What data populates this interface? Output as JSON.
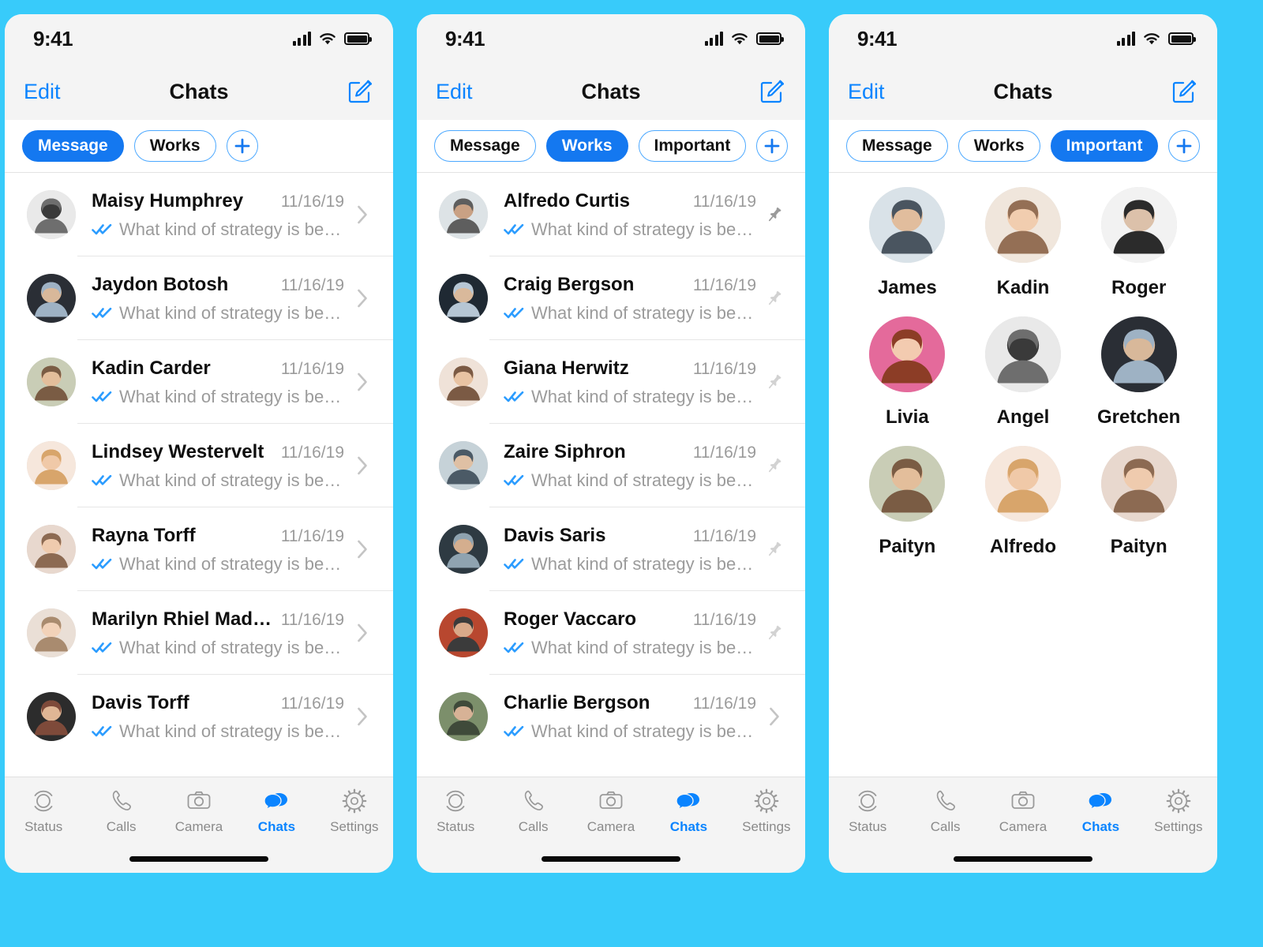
{
  "theme": {
    "background": "#38CBFA",
    "accent": "#0A84FF",
    "chip_active_bg": "#1478F0",
    "chip_border": "#4BA8FF",
    "header_bg": "#F4F4F4",
    "muted_text": "#9B9B9B",
    "tick_blue": "#2B9CFF"
  },
  "status_bar": {
    "time": "9:41",
    "signal_icon": "cellular-signal-icon",
    "wifi_icon": "wifi-icon",
    "battery_icon": "battery-icon"
  },
  "nav": {
    "edit_label": "Edit",
    "title": "Chats",
    "compose_icon": "compose-icon"
  },
  "tab_bar": {
    "items": [
      {
        "label": "Status",
        "icon": "status-rings-icon",
        "active": false
      },
      {
        "label": "Calls",
        "icon": "phone-handset-icon",
        "active": false
      },
      {
        "label": "Camera",
        "icon": "camera-icon",
        "active": false
      },
      {
        "label": "Chats",
        "icon": "chat-bubbles-icon",
        "active": true
      },
      {
        "label": "Settings",
        "icon": "gear-icon",
        "active": false
      }
    ]
  },
  "common": {
    "preview_text": "What kind of strategy is better?",
    "date": "11/16/19",
    "read_ticks_icon": "double-check-icon",
    "chevron_icon": "chevron-right-icon",
    "pin_icon": "pin-icon",
    "add_icon": "plus-icon"
  },
  "panels": [
    {
      "id": "panel-messages",
      "chips": [
        {
          "label": "Message",
          "active": true
        },
        {
          "label": "Works",
          "active": false
        }
      ],
      "has_important_chip": false,
      "view": "chat-list",
      "rows": [
        {
          "name": "Maisy Humphrey",
          "date": "11/16/19",
          "preview": "What kind of strategy is better?",
          "accessory": "chevron"
        },
        {
          "name": "Jaydon Botosh",
          "date": "11/16/19",
          "preview": "What kind of strategy is better?",
          "accessory": "chevron"
        },
        {
          "name": "Kadin Carder",
          "date": "11/16/19",
          "preview": "What kind of strategy is better?",
          "accessory": "chevron"
        },
        {
          "name": "Lindsey Westervelt",
          "date": "11/16/19",
          "preview": "What kind of strategy is better?",
          "accessory": "chevron"
        },
        {
          "name": "Rayna Torff",
          "date": "11/16/19",
          "preview": "What kind of strategy is better?",
          "accessory": "chevron"
        },
        {
          "name": "Marilyn Rhiel Madsen",
          "date": "11/16/19",
          "preview": "What kind of strategy is better?",
          "accessory": "chevron"
        },
        {
          "name": "Davis Torff",
          "date": "11/16/19",
          "preview": "What kind of strategy is better?",
          "accessory": "chevron"
        }
      ]
    },
    {
      "id": "panel-works",
      "chips": [
        {
          "label": "Message",
          "active": false
        },
        {
          "label": "Works",
          "active": true
        },
        {
          "label": "Important",
          "active": false
        }
      ],
      "has_important_chip": true,
      "view": "chat-list",
      "rows": [
        {
          "name": "Alfredo Curtis",
          "date": "11/16/19",
          "preview": "What kind of strategy is better?",
          "accessory": "pin"
        },
        {
          "name": "Craig Bergson",
          "date": "11/16/19",
          "preview": "What kind of strategy is better?",
          "accessory": "pin-light"
        },
        {
          "name": "Giana Herwitz",
          "date": "11/16/19",
          "preview": "What kind of strategy is better?",
          "accessory": "pin-light"
        },
        {
          "name": "Zaire Siphron",
          "date": "11/16/19",
          "preview": "What kind of strategy is better?",
          "accessory": "pin-light"
        },
        {
          "name": "Davis Saris",
          "date": "11/16/19",
          "preview": "What kind of strategy is better?",
          "accessory": "pin-light"
        },
        {
          "name": "Roger Vaccaro",
          "date": "11/16/19",
          "preview": "What kind of strategy is better?",
          "accessory": "pin-light"
        },
        {
          "name": "Charlie Bergson",
          "date": "11/16/19",
          "preview": "What kind of strategy is better?",
          "accessory": "chevron"
        }
      ]
    },
    {
      "id": "panel-important",
      "chips": [
        {
          "label": "Message",
          "active": false
        },
        {
          "label": "Works",
          "active": false
        },
        {
          "label": "Important",
          "active": true
        }
      ],
      "has_important_chip": true,
      "view": "contact-grid",
      "contacts": [
        {
          "name": "James"
        },
        {
          "name": "Kadin"
        },
        {
          "name": "Roger"
        },
        {
          "name": "Livia"
        },
        {
          "name": "Angel"
        },
        {
          "name": "Gretchen"
        },
        {
          "name": "Paityn"
        },
        {
          "name": "Alfredo"
        },
        {
          "name": "Paityn"
        }
      ]
    }
  ]
}
